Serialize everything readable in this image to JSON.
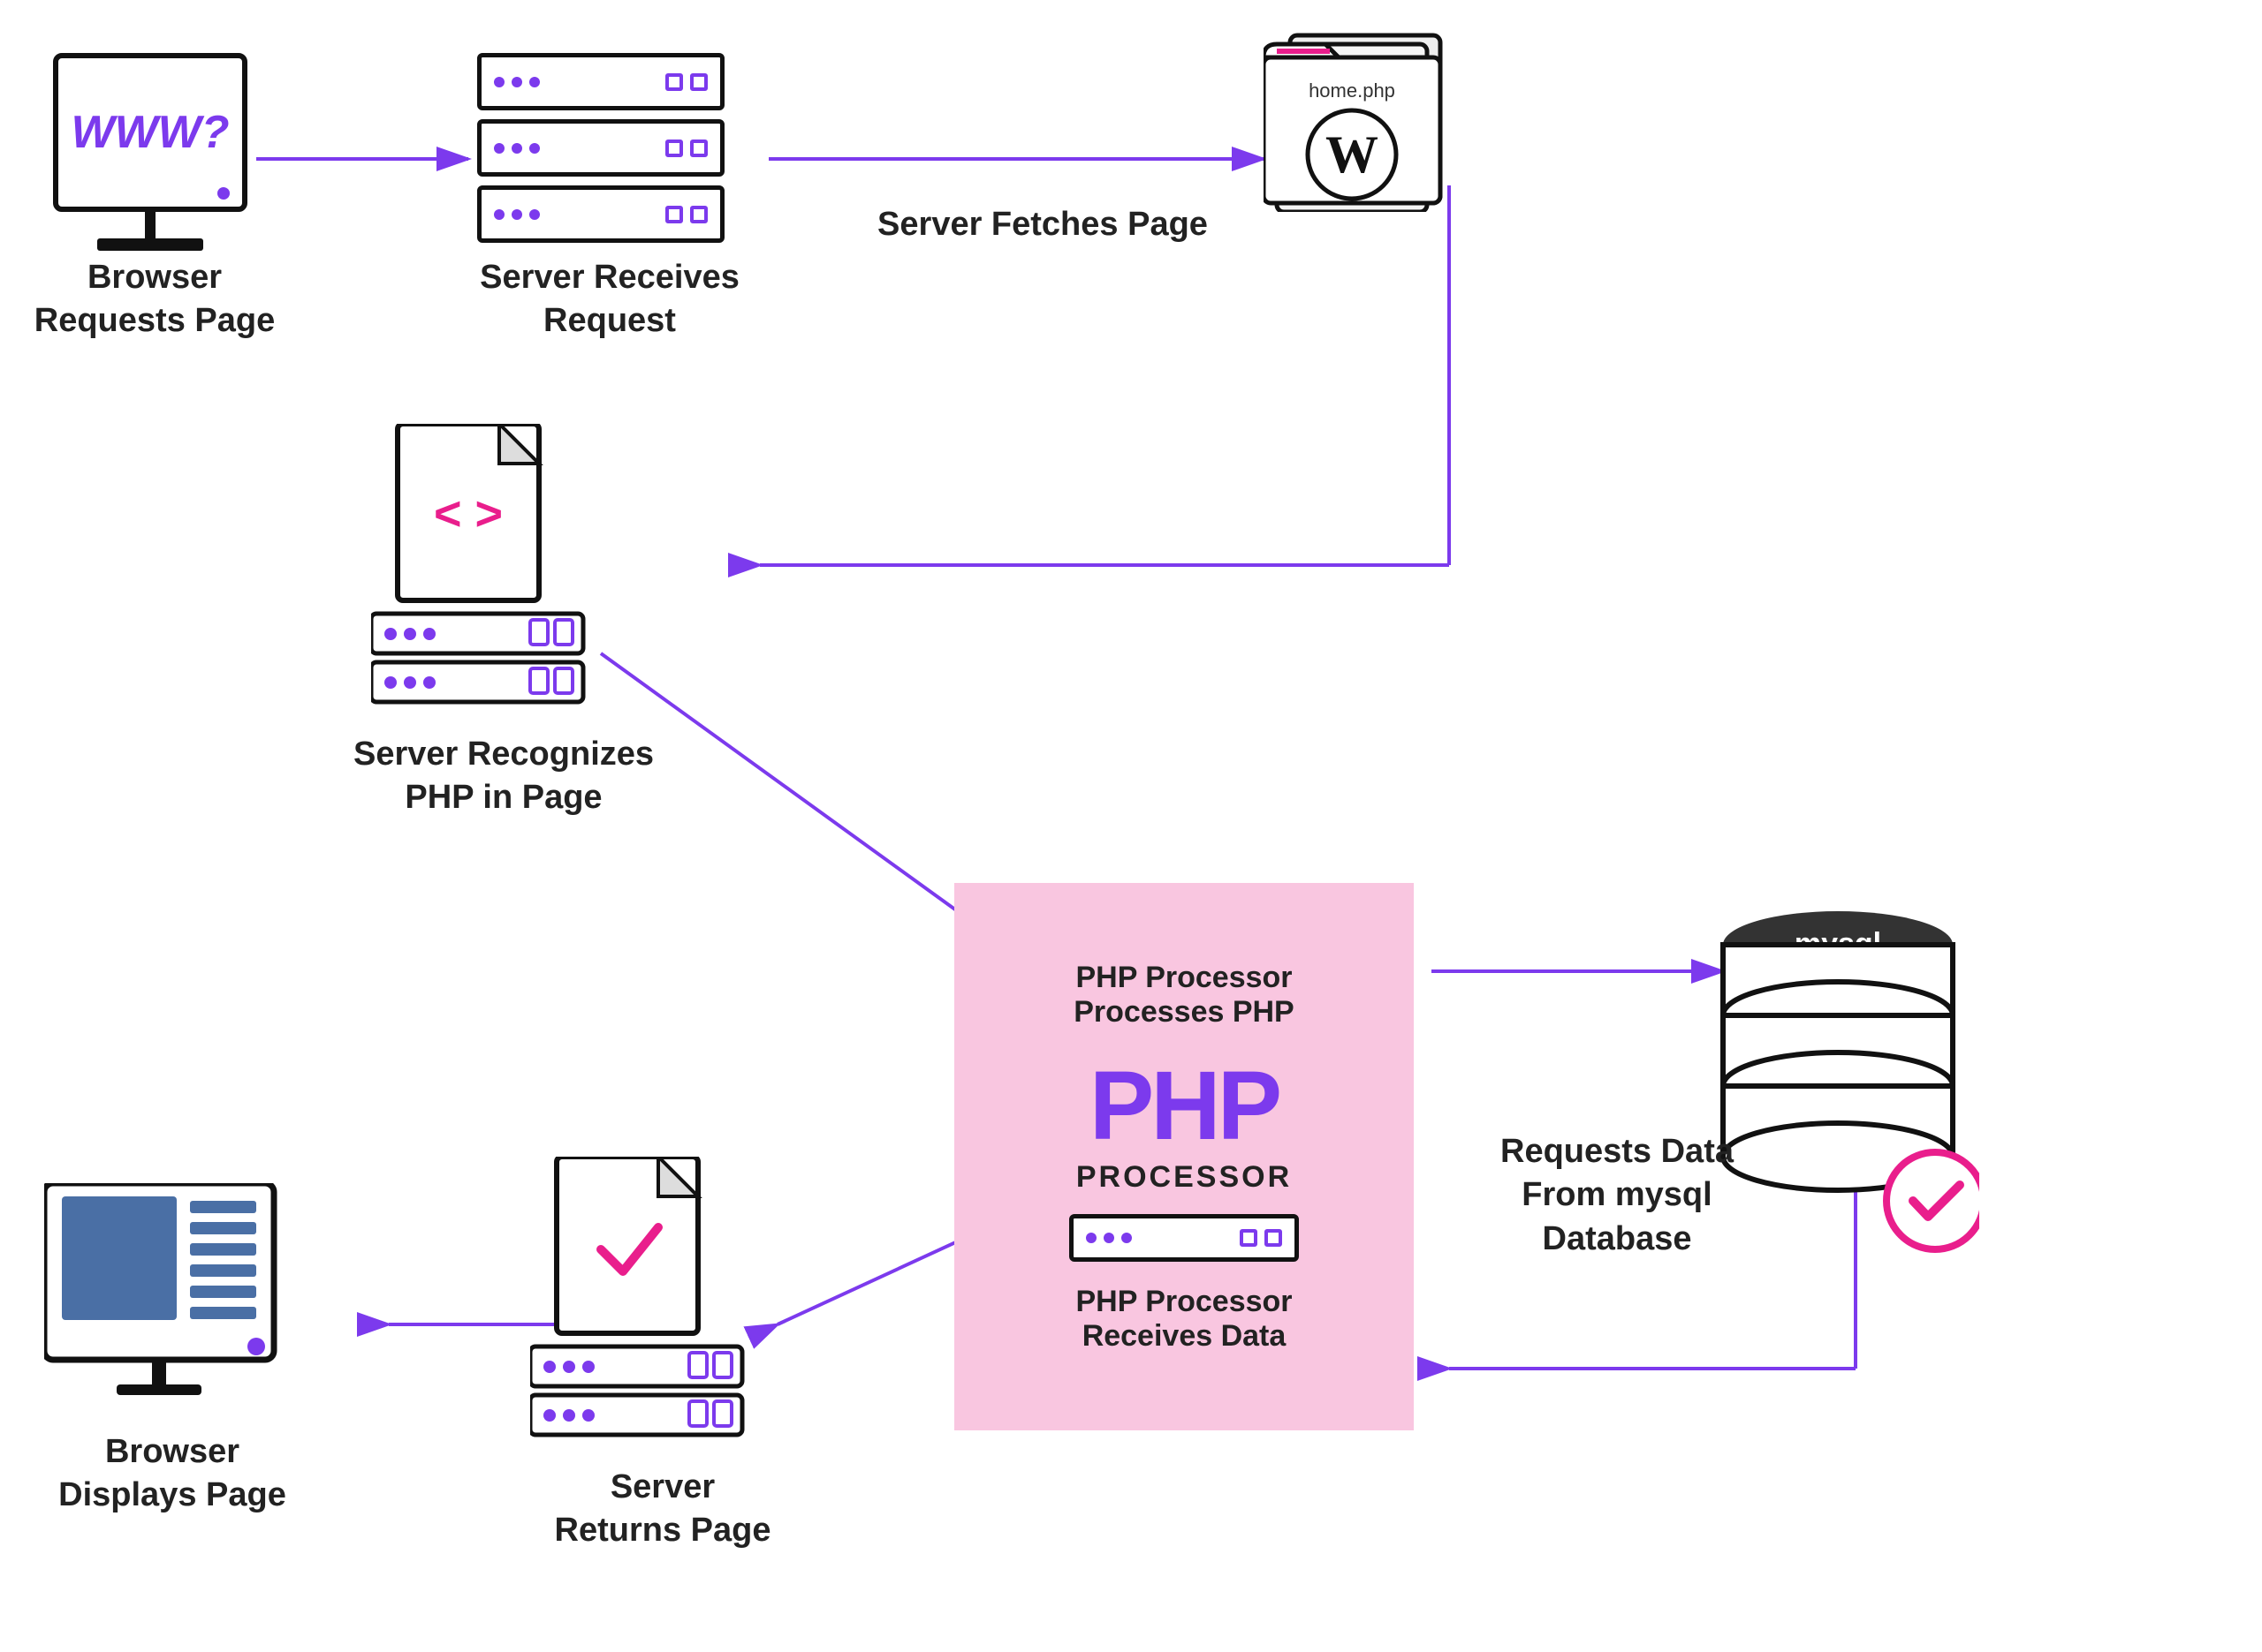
{
  "labels": {
    "browser_requests": "Browser\nRequests Page",
    "server_receives": "Server Receives\nRequest",
    "server_fetches": "Server Fetches Page",
    "server_recognizes": "Server Recognizes\nPHP in Page",
    "php_processor_processes": "PHP Processor\nProcesses PHP",
    "php_big": "PHP",
    "php_processor_text": "PROCESSOR",
    "php_processor_receives": "PHP Processor\nReceives Data",
    "requests_data": "Requests Data\nFrom mysql Database",
    "browser_displays": "Browser\nDisplays Page",
    "server_returns": "Server\nReturns Page",
    "home_php": "home.php",
    "mysql": "mysql",
    "www": "WWW?"
  },
  "colors": {
    "purple": "#7c3aed",
    "pink": "#e91e8c",
    "php_box_bg": "#f9c6e0",
    "black": "#111111",
    "blue_screen": "#4a6fa5",
    "white": "#ffffff"
  }
}
